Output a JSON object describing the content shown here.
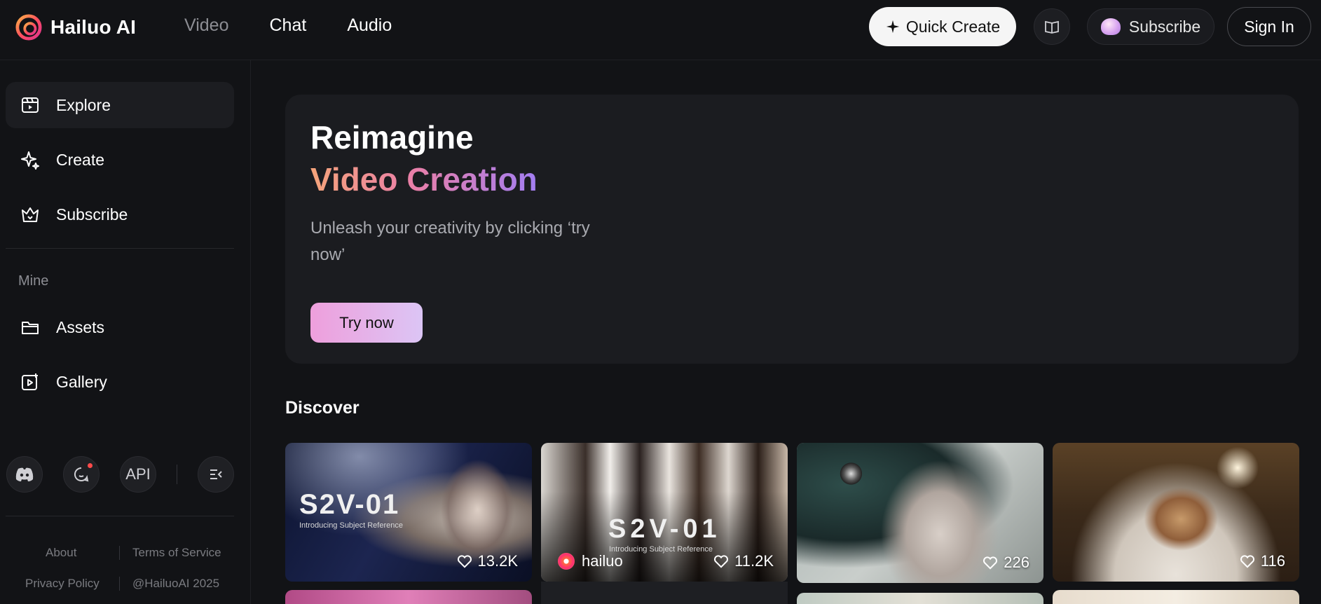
{
  "header": {
    "logo_text": "Hailuo AI",
    "nav": [
      {
        "label": "Video",
        "active": false
      },
      {
        "label": "Chat",
        "active": true
      },
      {
        "label": "Audio",
        "active": true
      }
    ],
    "quick_create": "Quick Create",
    "subscribe": "Subscribe",
    "sign_in": "Sign In"
  },
  "sidebar": {
    "items": [
      {
        "label": "Explore",
        "icon": "explore-icon",
        "active": true
      },
      {
        "label": "Create",
        "icon": "sparkle-icon",
        "active": false
      },
      {
        "label": "Subscribe",
        "icon": "crown-icon",
        "active": false
      }
    ],
    "mine_label": "Mine",
    "mine_items": [
      {
        "label": "Assets",
        "icon": "folder-icon"
      },
      {
        "label": "Gallery",
        "icon": "gallery-icon"
      }
    ],
    "api_label": "API",
    "footer": {
      "about": "About",
      "terms": "Terms of Service",
      "privacy": "Privacy Policy",
      "copyright": "@HailuoAI 2025"
    }
  },
  "hero": {
    "title_line1": "Reimagine",
    "title_line2": "Video Creation",
    "subtitle": "Unleash your creativity by clicking ‘try now’",
    "cta": "Try now"
  },
  "discover": {
    "title": "Discover",
    "cards": [
      {
        "likes": "13.2K",
        "overlay_title": "S2V-01",
        "overlay_sub": "Introducing Subject Reference"
      },
      {
        "likes": "11.2K",
        "author": "hailuo",
        "overlay_title": "S2V-01",
        "overlay_sub": "Introducing Subject Reference"
      },
      {
        "likes": "226"
      },
      {
        "likes": "116"
      }
    ]
  },
  "colors": {
    "background": "#121316",
    "panel": "#1b1c20",
    "accent_gradient_start": "#f5a47a",
    "accent_gradient_end": "#a27ef2"
  }
}
